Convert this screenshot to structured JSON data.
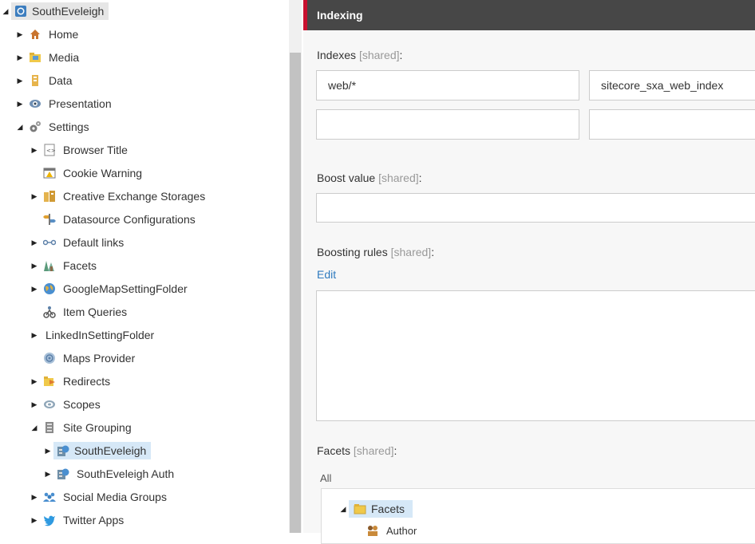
{
  "tree": {
    "root": "SouthEveleigh",
    "items": [
      {
        "label": "Home",
        "icon": "home-icon",
        "state": "collapsed"
      },
      {
        "label": "Media",
        "icon": "media-folder-icon",
        "state": "collapsed"
      },
      {
        "label": "Data",
        "icon": "data-icon",
        "state": "collapsed"
      },
      {
        "label": "Presentation",
        "icon": "eye-icon",
        "state": "collapsed"
      },
      {
        "label": "Settings",
        "icon": "gears-icon",
        "state": "expanded"
      },
      {
        "label": "Browser Title",
        "icon": "browser-title-icon",
        "state": "collapsed"
      },
      {
        "label": "Cookie Warning",
        "icon": "warning-window-icon",
        "state": "leaf"
      },
      {
        "label": "Creative Exchange Storages",
        "icon": "storage-icon",
        "state": "collapsed"
      },
      {
        "label": "Datasource Configurations",
        "icon": "signpost-icon",
        "state": "leaf"
      },
      {
        "label": "Default links",
        "icon": "links-icon",
        "state": "collapsed"
      },
      {
        "label": "Facets",
        "icon": "facets-icon",
        "state": "collapsed"
      },
      {
        "label": "GoogleMapSettingFolder",
        "icon": "globe-icon",
        "state": "collapsed"
      },
      {
        "label": "Item Queries",
        "icon": "query-icon",
        "state": "leaf"
      },
      {
        "label": "LinkedInSettingFolder",
        "icon": "none",
        "state": "collapsed"
      },
      {
        "label": "Maps Provider",
        "icon": "map-provider-icon",
        "state": "leaf"
      },
      {
        "label": "Redirects",
        "icon": "redirect-icon",
        "state": "collapsed"
      },
      {
        "label": "Scopes",
        "icon": "scope-icon",
        "state": "collapsed"
      },
      {
        "label": "Site Grouping",
        "icon": "site-grouping-icon",
        "state": "expanded"
      },
      {
        "label": "SouthEveleigh",
        "icon": "site-icon",
        "state": "collapsed"
      },
      {
        "label": "SouthEveleigh Auth",
        "icon": "site-icon",
        "state": "collapsed"
      },
      {
        "label": "Social Media Groups",
        "icon": "people-icon",
        "state": "collapsed"
      },
      {
        "label": "Twitter Apps",
        "icon": "twitter-icon",
        "state": "collapsed"
      }
    ]
  },
  "panel": {
    "title": "Indexing",
    "shared_tag": "[shared]",
    "colon": ":",
    "indexes": {
      "label": "Indexes",
      "values": [
        "web/*",
        "sitecore_sxa_web_index",
        "",
        ""
      ]
    },
    "boost": {
      "label": "Boost value",
      "value": ""
    },
    "boosting_rules": {
      "label": "Boosting rules",
      "edit_link": "Edit"
    },
    "facets": {
      "label": "Facets",
      "filter": "All",
      "tree_root": "Facets",
      "child": "Author"
    }
  },
  "colors": {
    "header_bg": "#474747",
    "accent": "#c8102e",
    "link": "#2f7bbf",
    "selection": "#d6e8f7"
  }
}
